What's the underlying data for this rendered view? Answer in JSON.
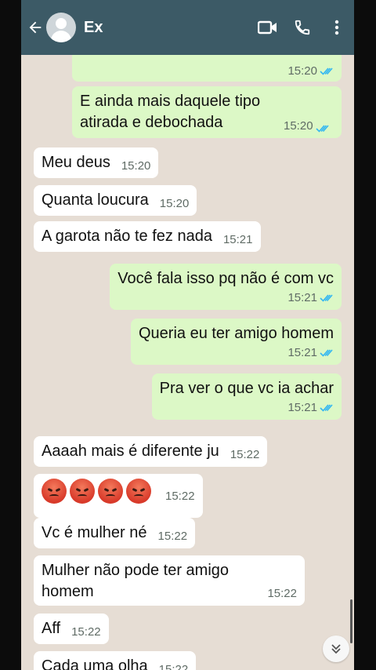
{
  "header": {
    "contact_name": "Ex",
    "icons": [
      "back-arrow-icon",
      "avatar-icon",
      "video-call-icon",
      "phone-icon",
      "more-vert-icon"
    ]
  },
  "colors": {
    "header_bg": "#3c5a66",
    "outgoing_bubble": "#dcf8c6",
    "incoming_bubble": "#ffffff",
    "read_ticks": "#34b7f1"
  },
  "messages": [
    {
      "dir": "out",
      "text": "",
      "time": "15:20",
      "read": true
    },
    {
      "dir": "out",
      "text": "E ainda mais daquele tipo atirada e debochada",
      "time": "15:20",
      "read": true
    },
    {
      "dir": "in",
      "text": "Meu deus",
      "time": "15:20"
    },
    {
      "dir": "in",
      "text": "Quanta loucura",
      "time": "15:20"
    },
    {
      "dir": "in",
      "text": "A garota não te fez nada",
      "time": "15:21"
    },
    {
      "dir": "out",
      "text": "Você fala isso pq não é com vc",
      "time": "15:21",
      "read": true
    },
    {
      "dir": "out",
      "text": "Queria eu ter amigo homem",
      "time": "15:21",
      "read": true
    },
    {
      "dir": "out",
      "text": "Pra ver o que vc ia achar",
      "time": "15:21",
      "read": true
    },
    {
      "dir": "in",
      "text": "Aaaah mais é diferente ju",
      "time": "15:22"
    },
    {
      "dir": "in",
      "text": "",
      "emoji": "angry-face-icon",
      "emoji_count": 4,
      "time": "15:22"
    },
    {
      "dir": "in",
      "text": "Vc é mulher né",
      "time": "15:22"
    },
    {
      "dir": "in",
      "text": "Mulher não pode ter amigo homem",
      "time": "15:22"
    },
    {
      "dir": "in",
      "text": "Aff",
      "time": "15:22"
    },
    {
      "dir": "in",
      "text": "Cada uma olha",
      "time": "15:22"
    }
  ],
  "scroll_down_icon": "double-chevron-down-icon"
}
